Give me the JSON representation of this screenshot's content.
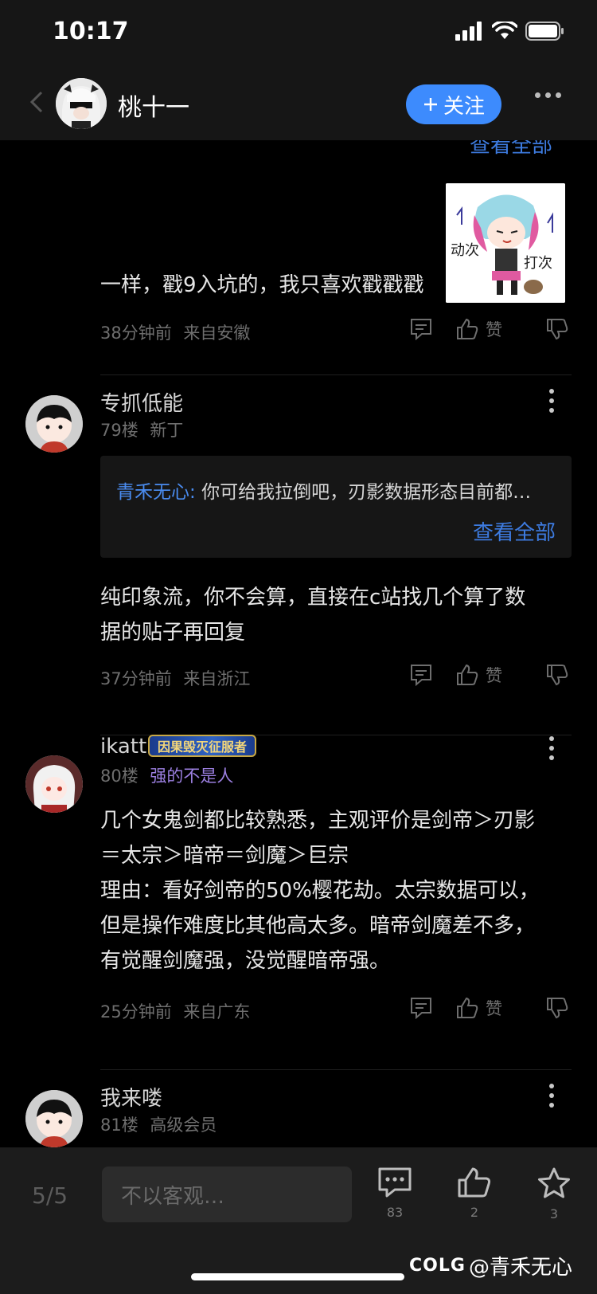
{
  "status": {
    "time": "10:17"
  },
  "nav": {
    "title": "桃十一",
    "follow_label": "关注"
  },
  "peek_text": "查看全部",
  "post1": {
    "text": "一样，戳9入坑的，我只喜欢戳戳戳",
    "sticker_text": {
      "left": "动次",
      "right": "打次"
    },
    "time": "38分钟前",
    "location": "来自安徽",
    "like_label": "赞"
  },
  "post2": {
    "username": "专抓低能",
    "floor": "79楼",
    "tag": "新丁",
    "quote_user": "青禾无心:",
    "quote_text": "你可给我拉倒吧，刃影数据形态目前都…",
    "quote_more": "查看全部",
    "text_lines": [
      "纯印象流，你不会算，直接在c站找几个算了数",
      "据的贴子再回复"
    ],
    "time": "37分钟前",
    "location": "来自浙江",
    "like_label": "赞"
  },
  "post3": {
    "username": "ikatt",
    "badge": "因果毁灭征服者",
    "floor": "80楼",
    "tag": "强的不是人",
    "text_lines": [
      "几个女鬼剑都比较熟悉，主观评价是剑帝＞刃影",
      "＝太宗＞暗帝＝剑魔＞巨宗",
      "理由：看好剑帝的50%樱花劫。太宗数据可以，",
      "但是操作难度比其他高太多。暗帝剑魔差不多，",
      "有觉醒剑魔强，没觉醒暗帝强。"
    ],
    "time": "25分钟前",
    "location": "来自广东",
    "like_label": "赞"
  },
  "post4": {
    "username": "我来喽",
    "floor": "81楼",
    "tag": "高级会员"
  },
  "bottom": {
    "page": "5/5",
    "placeholder": "不以客观…",
    "comment_count": "83",
    "like_count": "2",
    "star_count": "3"
  },
  "watermark": {
    "logo": "COLG",
    "text": "@青禾无心"
  },
  "colors": {
    "accent": "#3d8bfd",
    "link": "#3d7be0",
    "purple": "#9b7fe0"
  }
}
